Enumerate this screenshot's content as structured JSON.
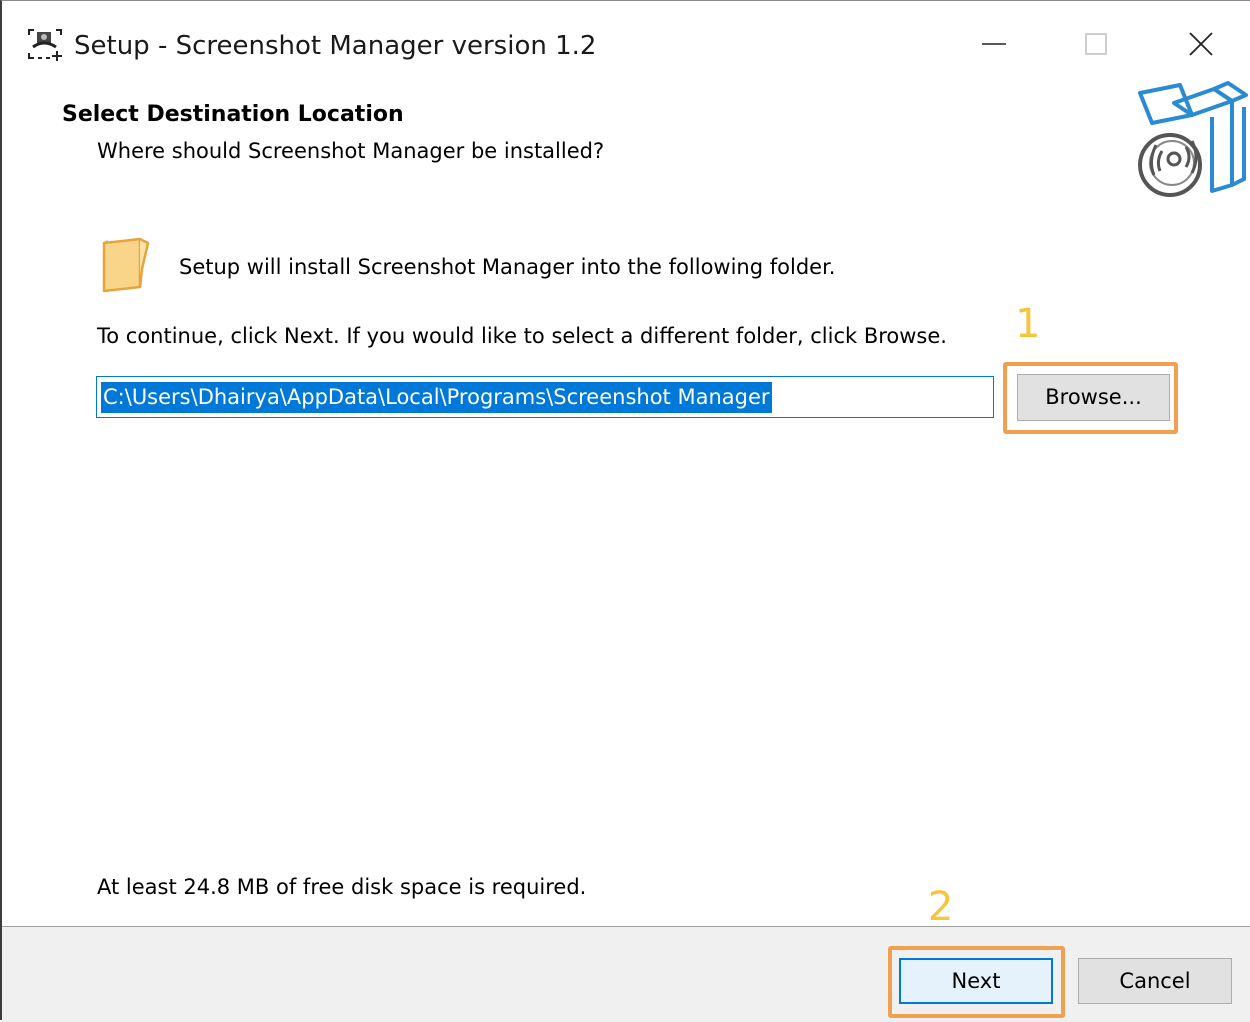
{
  "window": {
    "title": "Setup - Screenshot Manager version 1.2",
    "app_icon": "screenshot-app-icon",
    "controls": {
      "minimize_icon": "minimize-icon",
      "maximize_icon": "maximize-icon",
      "close_icon": "close-icon"
    }
  },
  "header": {
    "title": "Select Destination Location",
    "subtitle": "Where should Screenshot Manager be installed?",
    "image_icon": "software-box-disc-icon"
  },
  "body": {
    "folder_icon": "folder-icon",
    "info_text": "Setup will install Screenshot Manager into the following folder.",
    "continue_text": "To continue, click Next. If you would like to select a different folder, click Browse.",
    "path_value": "C:\\Users\\Dhairya\\AppData\\Local\\Programs\\Screenshot Manager",
    "browse_label": "Browse...",
    "disk_space_text": "At least 24.8 MB of free disk space is required."
  },
  "footer": {
    "next_label": "Next",
    "cancel_label": "Cancel"
  },
  "annotations": {
    "step1_label": "1",
    "step2_label": "2",
    "highlight_color": "#f0a050",
    "number_color": "#f7c53b"
  },
  "colors": {
    "selection": "#0078d7",
    "button_face": "#e1e1e1",
    "footer_bg": "#f0f0f0"
  }
}
